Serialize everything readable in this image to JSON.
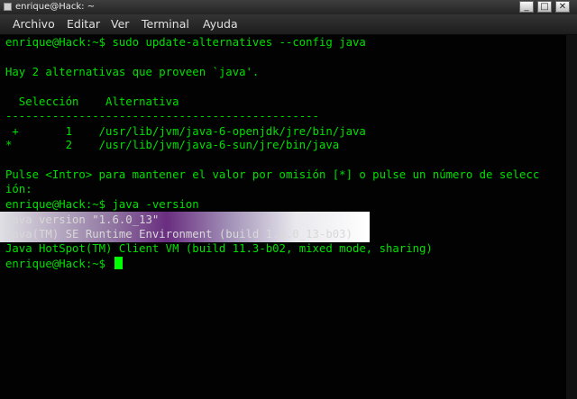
{
  "window": {
    "title": "enrique@Hack: ~",
    "controls": {
      "minimize": "_",
      "maximize": "□",
      "close": "✕"
    }
  },
  "menu": [
    "Archivo",
    "Editar",
    "Ver",
    "Terminal",
    "Ayuda"
  ],
  "terminal": {
    "lines": [
      "enrique@Hack:~$ sudo update-alternatives --config java",
      "",
      "Hay 2 alternativas que proveen `java'.",
      "",
      "  Selección    Alternativa",
      "-----------------------------------------------",
      " +       1    /usr/lib/jvm/java-6-openjdk/jre/bin/java",
      "*        2    /usr/lib/jvm/java-6-sun/jre/bin/java",
      "",
      "Pulse <Intro> para mantener el valor por omisión [*] o pulse un número de selecc",
      "ión:",
      "enrique@Hack:~$ java -version",
      "java version \"1.6.0_13\"",
      "Java(TM) SE Runtime Environment (build 1.6.0_13-b03)",
      "Java HotSpot(TM) Client VM (build 11.3-b02, mixed mode, sharing)",
      "enrique@Hack:~$ "
    ]
  },
  "colors": {
    "text": "#00e000",
    "background": "#020202",
    "cursor": "#00ff00"
  }
}
